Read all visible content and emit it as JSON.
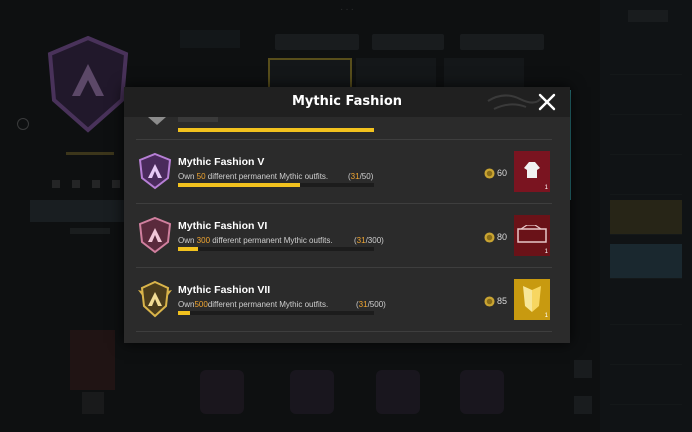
{
  "dialog": {
    "title": "Mythic Fashion",
    "close_icon": "close-icon"
  },
  "achievements": [
    {
      "name": "Mythic Fashion V",
      "desc_prefix": "Own ",
      "desc_target": "50",
      "desc_suffix": " different permanent Mythic outfits.",
      "progress_current": "31",
      "progress_total": "/50",
      "progress_fraction": 0.62,
      "points": "60",
      "reward_count": "1",
      "badge_color": "#8c4aa0",
      "reward_bg": "#7a1420"
    },
    {
      "name": "Mythic Fashion VI",
      "desc_prefix": "Own ",
      "desc_target": "300",
      "desc_suffix": " different permanent Mythic outfits.",
      "progress_current": "31",
      "progress_total": "/300",
      "progress_fraction": 0.103,
      "points": "80",
      "reward_count": "1",
      "badge_color": "#a0506e",
      "reward_bg": "#6a1218"
    },
    {
      "name": "Mythic Fashion VII",
      "desc_prefix": "Own",
      "desc_target": "500",
      "desc_suffix": "different permanent Mythic outfits.",
      "progress_current": "31",
      "progress_total": "/500",
      "progress_fraction": 0.062,
      "points": "85",
      "reward_count": "1",
      "badge_color": "#b8953a",
      "reward_bg": "#c89a10"
    }
  ],
  "colors": {
    "accent_orange": "#f0a530",
    "progress_yellow": "#f2c21e"
  },
  "background_ui": {
    "top_dots": "···"
  }
}
